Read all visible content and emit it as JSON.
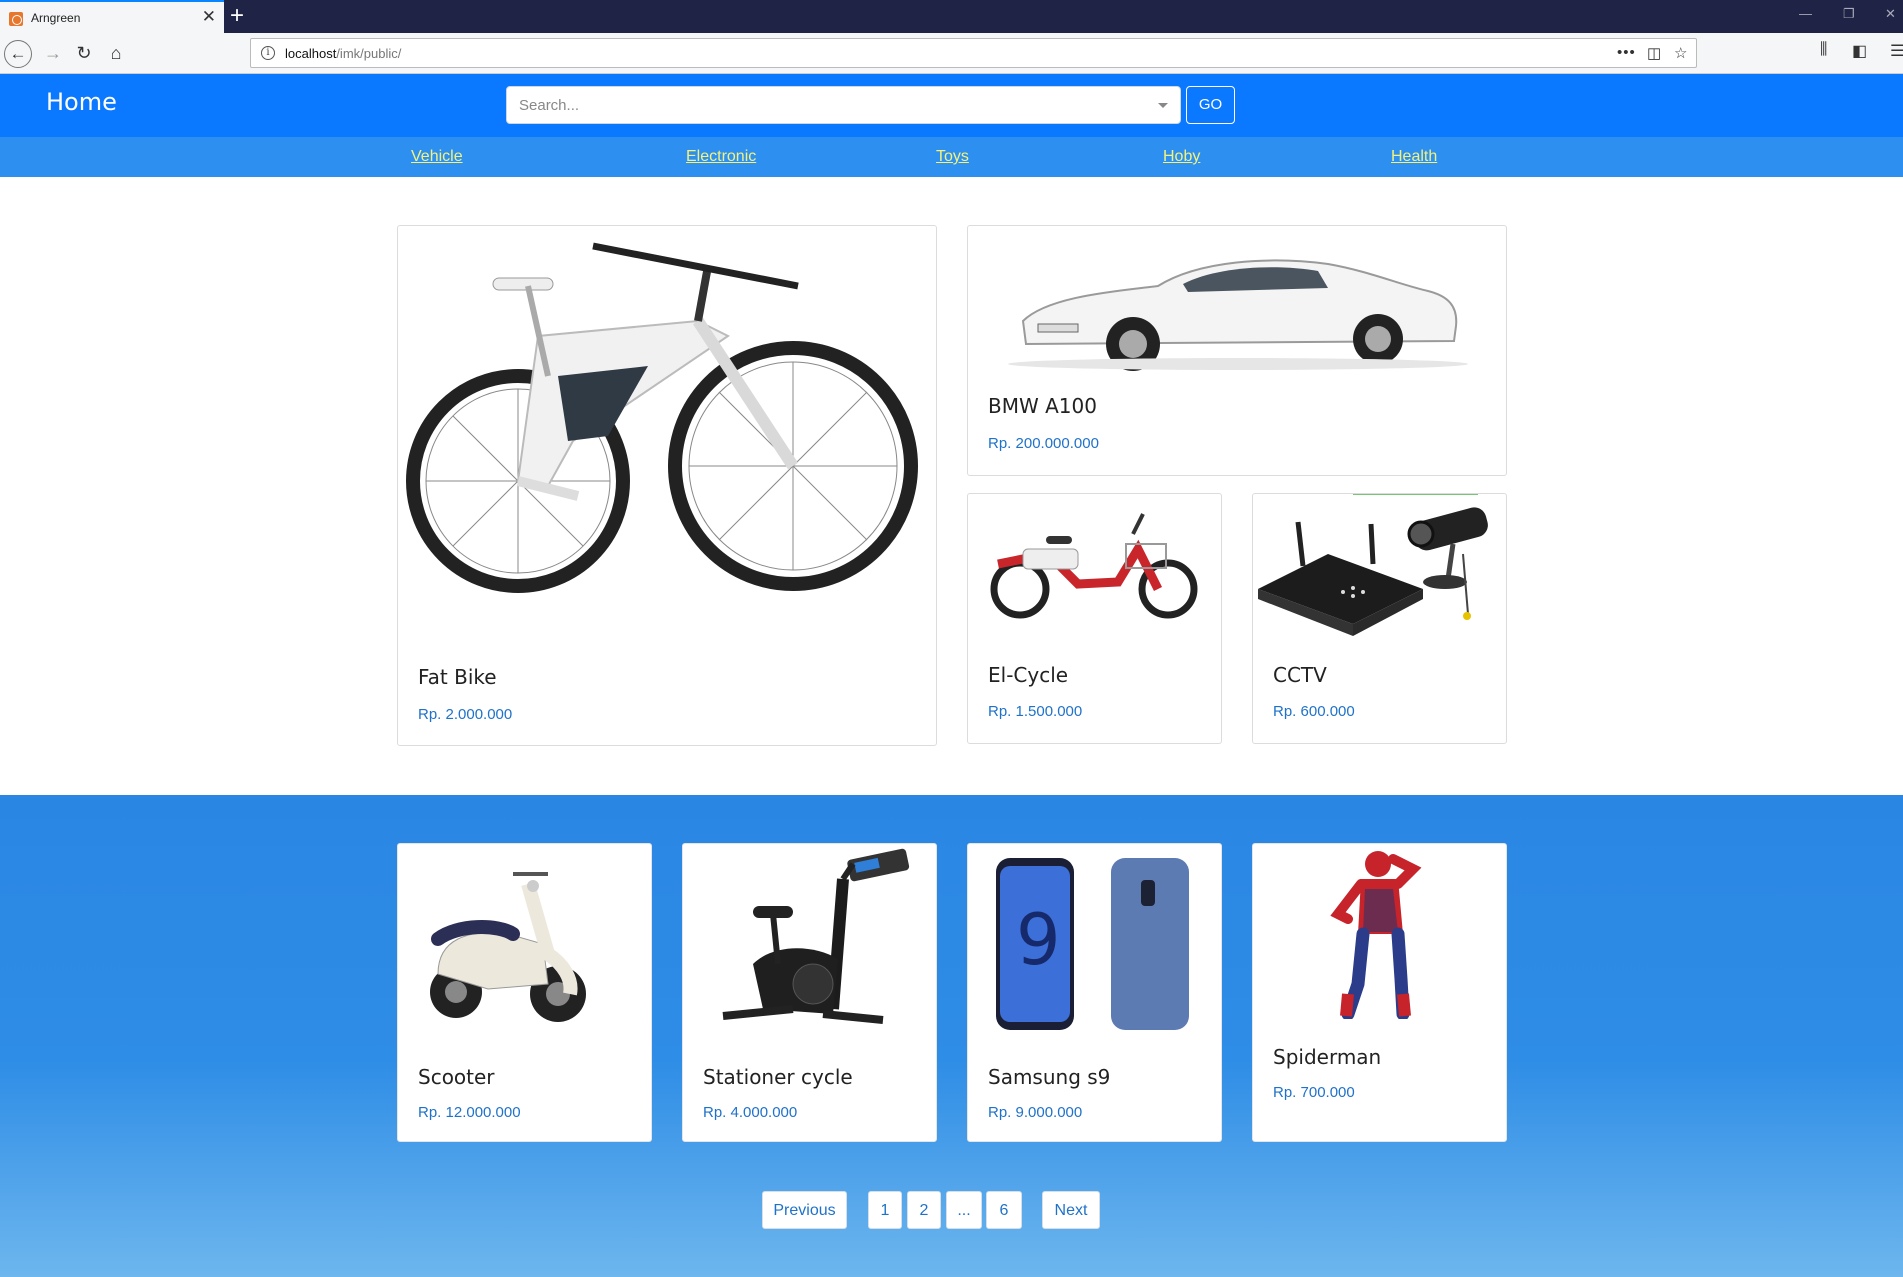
{
  "browser": {
    "tab_title": "Arngreen",
    "url_host": "localhost",
    "url_path": "/imk/public/"
  },
  "site": {
    "brand": "Home",
    "search_placeholder": "Search...",
    "go_label": "GO",
    "categories": [
      "Vehicle",
      "Electronic",
      "Toys",
      "Hoby",
      "Health"
    ]
  },
  "featured": [
    {
      "name": "Fat Bike",
      "price": "Rp. 2.000.000",
      "image": "mountain-bike"
    },
    {
      "name": "BMW A100",
      "price": "Rp. 200.000.000",
      "image": "white-car"
    },
    {
      "name": "El-Cycle",
      "price": "Rp. 1.500.000",
      "image": "electric-bicycle"
    },
    {
      "name": "CCTV",
      "price": "Rp. 600.000",
      "image": "cctv-recorder"
    }
  ],
  "products": [
    {
      "name": "Scooter",
      "price": "Rp. 12.000.000",
      "image": "scooter"
    },
    {
      "name": "Stationer cycle",
      "price": "Rp. 4.000.000",
      "image": "exercise-bike"
    },
    {
      "name": "Samsung s9",
      "price": "Rp. 9.000.000",
      "image": "smartphone"
    },
    {
      "name": "Spiderman",
      "price": "Rp. 700.000",
      "image": "action-figure"
    }
  ],
  "pagination": {
    "previous": "Previous",
    "pages": [
      "1",
      "2",
      "...",
      "6"
    ],
    "next": "Next"
  },
  "colors": {
    "header_blue": "#0b79ff",
    "category_bar": "#2d8ff0",
    "category_link": "#f4f27a",
    "price_blue": "#1f72c9"
  }
}
